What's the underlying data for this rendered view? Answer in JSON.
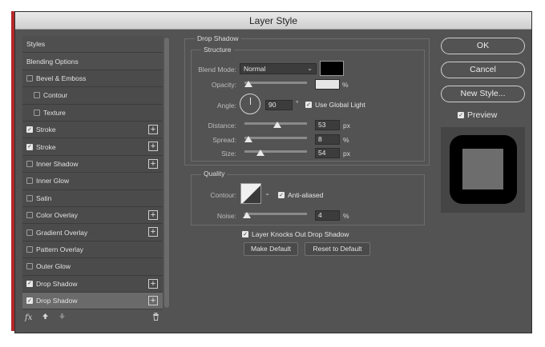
{
  "window": {
    "title": "Layer Style"
  },
  "styles_list": [
    {
      "label": "Styles",
      "checkbox": false,
      "checked": false,
      "plus": false,
      "selected": false,
      "indent": 0
    },
    {
      "label": "Blending Options",
      "checkbox": false,
      "checked": false,
      "plus": false,
      "selected": false,
      "indent": 0
    },
    {
      "label": "Bevel & Emboss",
      "checkbox": true,
      "checked": false,
      "plus": false,
      "selected": false,
      "indent": 0
    },
    {
      "label": "Contour",
      "checkbox": true,
      "checked": false,
      "plus": false,
      "selected": false,
      "indent": 1
    },
    {
      "label": "Texture",
      "checkbox": true,
      "checked": false,
      "plus": false,
      "selected": false,
      "indent": 1
    },
    {
      "label": "Stroke",
      "checkbox": true,
      "checked": true,
      "plus": true,
      "selected": false,
      "indent": 0
    },
    {
      "label": "Stroke",
      "checkbox": true,
      "checked": true,
      "plus": true,
      "selected": false,
      "indent": 0
    },
    {
      "label": "Inner Shadow",
      "checkbox": true,
      "checked": false,
      "plus": true,
      "selected": false,
      "indent": 0
    },
    {
      "label": "Inner Glow",
      "checkbox": true,
      "checked": false,
      "plus": false,
      "selected": false,
      "indent": 0
    },
    {
      "label": "Satin",
      "checkbox": true,
      "checked": false,
      "plus": false,
      "selected": false,
      "indent": 0
    },
    {
      "label": "Color Overlay",
      "checkbox": true,
      "checked": false,
      "plus": true,
      "selected": false,
      "indent": 0
    },
    {
      "label": "Gradient Overlay",
      "checkbox": true,
      "checked": false,
      "plus": true,
      "selected": false,
      "indent": 0
    },
    {
      "label": "Pattern Overlay",
      "checkbox": true,
      "checked": false,
      "plus": false,
      "selected": false,
      "indent": 0
    },
    {
      "label": "Outer Glow",
      "checkbox": true,
      "checked": false,
      "plus": false,
      "selected": false,
      "indent": 0
    },
    {
      "label": "Drop Shadow",
      "checkbox": true,
      "checked": true,
      "plus": true,
      "selected": false,
      "indent": 0
    },
    {
      "label": "Drop Shadow",
      "checkbox": true,
      "checked": true,
      "plus": true,
      "selected": true,
      "indent": 0
    }
  ],
  "bottom_icons": [
    "fx-icon",
    "arrow-up-icon",
    "arrow-down-icon",
    "trash-icon"
  ],
  "bottom_fx_text": "fx",
  "drop_shadow": {
    "section_title": "Drop Shadow",
    "structure_title": "Structure",
    "blend_mode": {
      "label": "Blend Mode:",
      "value": "Normal",
      "color": "#000000"
    },
    "opacity": {
      "label": "Opacity:",
      "value": "",
      "unit": "%",
      "slider_fraction": 0.07
    },
    "angle": {
      "label": "Angle:",
      "value": "90",
      "unit": "°",
      "use_global_light_label": "Use Global Light",
      "use_global_light": true
    },
    "distance": {
      "label": "Distance:",
      "value": "53",
      "unit": "px",
      "slider_fraction": 0.53
    },
    "spread": {
      "label": "Spread:",
      "value": "8",
      "unit": "%",
      "slider_fraction": 0.06
    },
    "size": {
      "label": "Size:",
      "value": "54",
      "unit": "px",
      "slider_fraction": 0.25
    }
  },
  "quality": {
    "title": "Quality",
    "contour_label": "Contour:",
    "anti_aliased_label": "Anti-aliased",
    "anti_aliased": true,
    "noise": {
      "label": "Noise:",
      "value": "4",
      "unit": "%",
      "slider_fraction": 0.04
    }
  },
  "knockout": {
    "label": "Layer Knocks Out Drop Shadow",
    "checked": true
  },
  "buttons": {
    "make_default": "Make Default",
    "reset_default": "Reset to Default",
    "ok": "OK",
    "cancel": "Cancel",
    "new_style": "New Style..."
  },
  "preview": {
    "label": "Preview",
    "checked": true
  }
}
